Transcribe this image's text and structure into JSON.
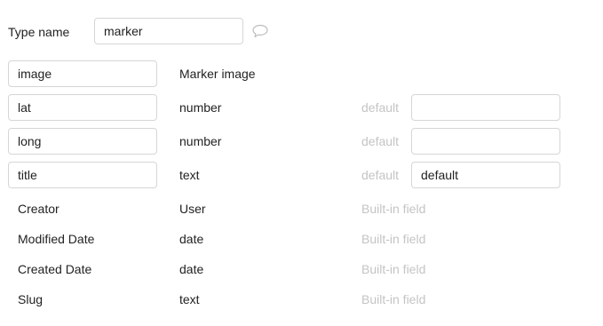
{
  "type_name": {
    "label": "Type name",
    "value": "marker"
  },
  "fields": [
    {
      "name": "image",
      "type": "Marker image"
    },
    {
      "name": "lat",
      "type": "number",
      "default_label": "default",
      "default_value": ""
    },
    {
      "name": "long",
      "type": "number",
      "default_label": "default",
      "default_value": ""
    },
    {
      "name": "title",
      "type": "text",
      "default_label": "default",
      "default_value": "default"
    }
  ],
  "builtin_fields": [
    {
      "name": "Creator",
      "type": "User",
      "note": "Built-in field"
    },
    {
      "name": "Modified Date",
      "type": "date",
      "note": "Built-in field"
    },
    {
      "name": "Created Date",
      "type": "date",
      "note": "Built-in field"
    },
    {
      "name": "Slug",
      "type": "text",
      "note": "Built-in field"
    }
  ],
  "icons": {
    "comment": "comment-icon"
  },
  "colors": {
    "border": "#d6d6d6",
    "muted_text": "#c4c4c4",
    "text": "#222222"
  }
}
